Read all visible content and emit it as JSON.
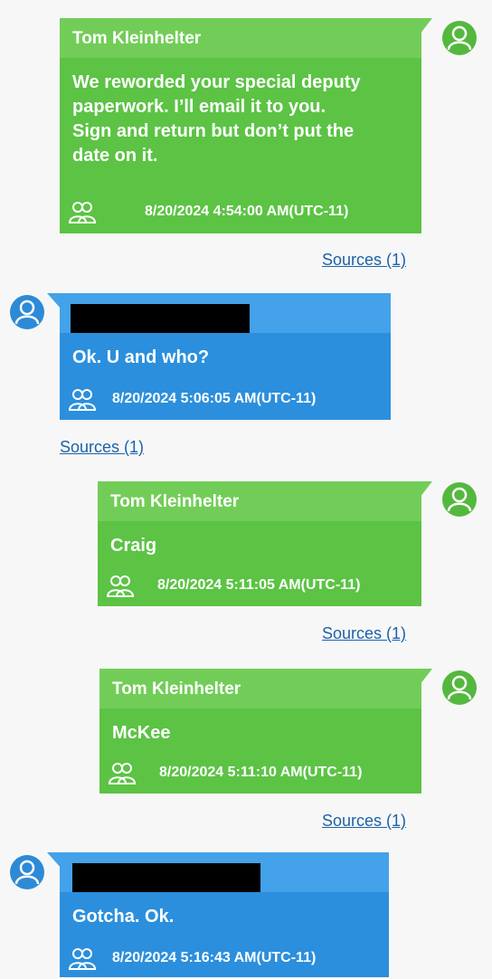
{
  "colors": {
    "outgoing_body": "#5cc345",
    "outgoing_header": "#72cd58",
    "incoming_body": "#2b8fdd",
    "incoming_header": "#43a2ea",
    "link": "#1c62a8"
  },
  "messages": [
    {
      "direction": "outgoing",
      "sender": "Tom Kleinhelter",
      "lines": [
        "We reworded your special deputy",
        "paperwork. I’ll email it to you.",
        "Sign and return but don’t put the",
        "date on it."
      ],
      "timestamp": "8/20/2024 4:54:00 AM(UTC-11)",
      "sources_label": "Sources (1)"
    },
    {
      "direction": "incoming",
      "sender_redacted": true,
      "lines": [
        "Ok.  U and who?"
      ],
      "timestamp": "8/20/2024 5:06:05 AM(UTC-11)",
      "sources_label": "Sources (1)"
    },
    {
      "direction": "outgoing",
      "sender": "Tom Kleinhelter",
      "lines": [
        "Craig"
      ],
      "timestamp": "8/20/2024 5:11:05 AM(UTC-11)",
      "sources_label": "Sources (1)"
    },
    {
      "direction": "outgoing",
      "sender": "Tom Kleinhelter",
      "lines": [
        "McKee"
      ],
      "timestamp": "8/20/2024 5:11:10 AM(UTC-11)",
      "sources_label": "Sources (1)"
    },
    {
      "direction": "incoming",
      "sender_redacted": true,
      "lines": [
        "Gotcha.  Ok."
      ],
      "timestamp": "8/20/2024 5:16:43 AM(UTC-11)"
    }
  ],
  "icons": {
    "avatar": "user-avatar-icon",
    "participants": "participants-icon"
  }
}
